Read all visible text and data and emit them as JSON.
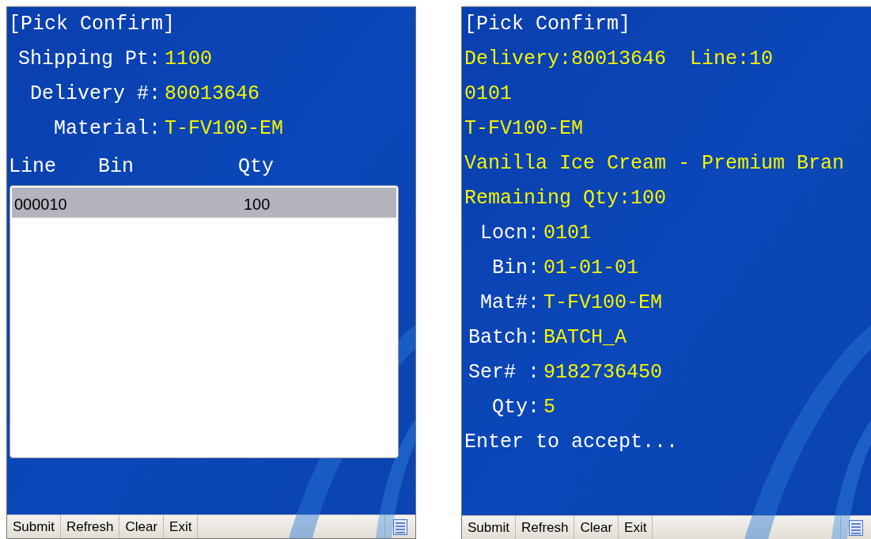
{
  "screens": [
    {
      "kind": "list",
      "title": "[Pick Confirm]",
      "fields": [
        {
          "label": "Shipping Pt:",
          "value": "1100"
        },
        {
          "label": "Delivery #:",
          "value": "80013646"
        },
        {
          "label": "Material:",
          "value": "T-FV100-EM"
        }
      ],
      "columns": [
        "Line",
        "Bin",
        "Qty"
      ],
      "rows": [
        {
          "line": "000010",
          "qty": "100",
          "selected": true
        }
      ],
      "softkeys": [
        "Submit",
        "Refresh",
        "Clear",
        "Exit"
      ]
    },
    {
      "kind": "detail",
      "title": "[Pick Confirm]",
      "lines": [
        "Delivery:80013646  Line:10",
        "0101",
        "T-FV100-EM",
        "Vanilla Ice Cream - Premium Bran",
        "Remaining Qty:100"
      ],
      "fields": [
        {
          "label": "Locn:",
          "value": "0101"
        },
        {
          "label": "Bin:",
          "value": "01-01-01"
        },
        {
          "label": "Mat#:",
          "value": "T-FV100-EM"
        },
        {
          "label": "Batch:",
          "value": "BATCH_A"
        },
        {
          "label": "Ser# :",
          "value": "9182736450"
        },
        {
          "label": "Qty:",
          "value": "5"
        }
      ],
      "prompt": "Enter to accept...",
      "softkeys": [
        "Submit",
        "Refresh",
        "Clear",
        "Exit"
      ]
    }
  ]
}
